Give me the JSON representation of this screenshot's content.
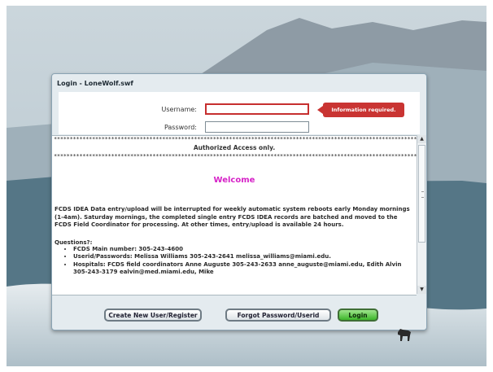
{
  "window": {
    "title": "Login - LoneWolf.swf"
  },
  "form": {
    "username_label": "Username:",
    "password_label": "Password:",
    "username_value": "",
    "password_value": "",
    "error_tooltip": "Information required."
  },
  "message": {
    "stars": "****************************************************************************************************************************************",
    "authorized": "Authorized Access only.",
    "welcome": "Welcome",
    "paragraph": "FCDS IDEA Data entry/upload will be interrupted for weekly automatic system reboots early Monday mornings (1-4am). Saturday mornings, the completed single entry FCDS IDEA records are batched and moved to the FCDS Field Coordinator for processing. At other times, entry/upload is available 24 hours.",
    "questions_heading": "Questions?:",
    "bullets": [
      "FCDS Main number: 305-243-4600",
      "Userid/Passwords: Melissa Williams 305-243-2641 melissa_williams@miami.edu.",
      "Hospitals: FCDS field coordinators Anne Auguste 305-243-2633 anne_auguste@miami.edu, Edith Alvin 305-243-3179 ealvin@med.miami.edu, Mike"
    ]
  },
  "buttons": {
    "create": "Create New User/Register",
    "forgot": "Forgot Password/Userid",
    "login": "Login"
  },
  "colors": {
    "error": "#c93432",
    "welcome": "#d622c7",
    "login_button": "#3cb529"
  }
}
